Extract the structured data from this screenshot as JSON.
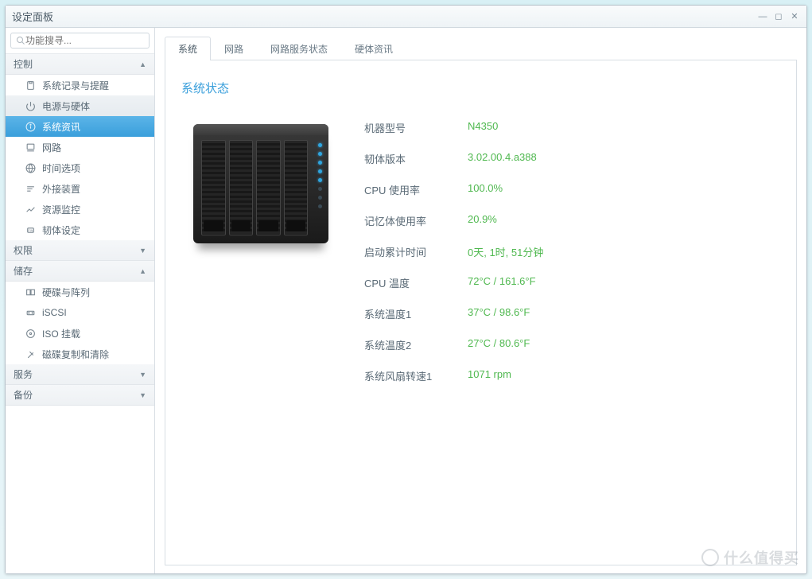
{
  "window": {
    "title": "设定面板"
  },
  "search": {
    "placeholder": "功能搜寻..."
  },
  "sidebar": {
    "categories": [
      {
        "label": "控制",
        "expanded": true,
        "items": [
          {
            "label": "系统记录与提醒",
            "icon": "clipboard-icon"
          },
          {
            "label": "电源与硬体",
            "icon": "power-icon",
            "light": true
          },
          {
            "label": "系统资讯",
            "icon": "info-icon",
            "selected": true
          },
          {
            "label": "网路",
            "icon": "network-icon"
          },
          {
            "label": "时间选项",
            "icon": "globe-icon"
          },
          {
            "label": "外接装置",
            "icon": "external-icon"
          },
          {
            "label": "资源监控",
            "icon": "chart-icon"
          },
          {
            "label": "韧体设定",
            "icon": "firmware-icon"
          }
        ]
      },
      {
        "label": "权限",
        "expanded": false,
        "items": []
      },
      {
        "label": "储存",
        "expanded": true,
        "items": [
          {
            "label": "硬碟与阵列",
            "icon": "disk-icon"
          },
          {
            "label": "iSCSI",
            "icon": "iscsi-icon"
          },
          {
            "label": "ISO 挂载",
            "icon": "iso-icon"
          },
          {
            "label": "磁碟复制和清除",
            "icon": "erase-icon"
          }
        ]
      },
      {
        "label": "服务",
        "expanded": false,
        "items": []
      },
      {
        "label": "备份",
        "expanded": false,
        "items": []
      }
    ]
  },
  "tabs": [
    {
      "label": "系统",
      "active": true
    },
    {
      "label": "网路"
    },
    {
      "label": "网路服务状态"
    },
    {
      "label": "硬体资讯"
    }
  ],
  "section": {
    "title": "系统状态"
  },
  "info": [
    {
      "label": "机器型号",
      "value": "N4350"
    },
    {
      "label": "韧体版本",
      "value": "3.02.00.4.a388"
    },
    {
      "label": "CPU 使用率",
      "value": "100.0%"
    },
    {
      "label": "记忆体使用率",
      "value": "20.9%"
    },
    {
      "label": "启动累计时间",
      "value": "0天, 1时, 51分钟"
    },
    {
      "label": "CPU 温度",
      "value": "72°C / 161.6°F"
    },
    {
      "label": "系统温度1",
      "value": "37°C / 98.6°F"
    },
    {
      "label": "系统温度2",
      "value": "27°C / 80.6°F"
    },
    {
      "label": "系统风扇转速1",
      "value": "1071 rpm"
    }
  ],
  "watermark": {
    "text": "什么值得买"
  }
}
